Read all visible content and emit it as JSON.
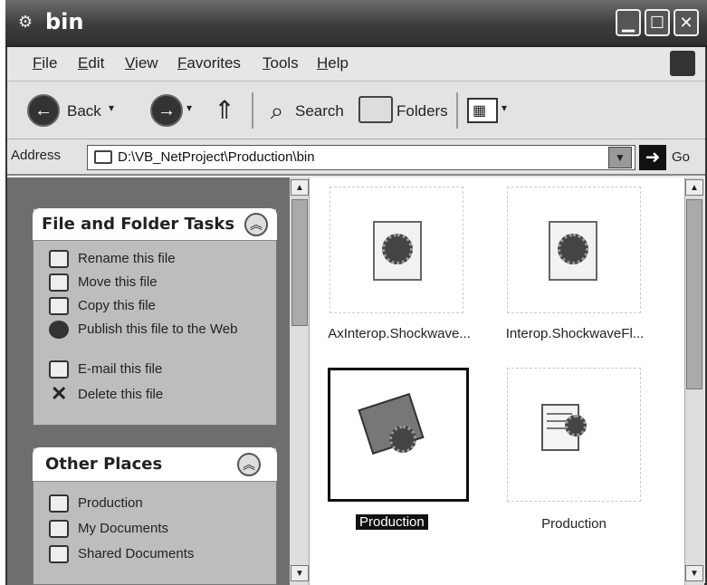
{
  "window": {
    "title": "bin"
  },
  "menu": [
    "File",
    "Edit",
    "View",
    "Favorites",
    "Tools",
    "Help"
  ],
  "toolbar": {
    "back": "Back",
    "search": "Search",
    "folders": "Folders"
  },
  "address": {
    "label": "Address",
    "path": "D:\\VB_NetProject\\Production\\bin",
    "go": "Go"
  },
  "tasks": {
    "title": "File and Folder Tasks",
    "items": [
      {
        "label": "Rename this file",
        "icon": "rename-icon"
      },
      {
        "label": "Move this file",
        "icon": "move-icon"
      },
      {
        "label": "Copy this file",
        "icon": "copy-icon"
      },
      {
        "label": "Publish this file to the Web",
        "icon": "globe-icon"
      },
      {
        "label": "E-mail this file",
        "icon": "email-icon"
      },
      {
        "label": "Delete this file",
        "icon": "delete-icon"
      }
    ]
  },
  "places": {
    "title": "Other Places",
    "items": [
      {
        "label": "Production",
        "icon": "folder-icon"
      },
      {
        "label": "My Documents",
        "icon": "folder-icon"
      },
      {
        "label": "Shared Documents",
        "icon": "folder-icon"
      }
    ]
  },
  "files": [
    {
      "label": "AxInterop.Shockwave...",
      "icon": "dll-file-icon",
      "selected": false
    },
    {
      "label": "Interop.ShockwaveFl...",
      "icon": "dll-file-icon",
      "selected": false
    },
    {
      "label": "Production",
      "icon": "application-exe-icon",
      "selected": true
    },
    {
      "label": "Production",
      "icon": "config-file-icon",
      "selected": false
    }
  ]
}
